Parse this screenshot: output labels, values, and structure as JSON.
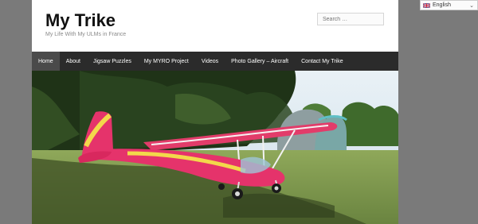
{
  "site": {
    "title": "My Trike",
    "tagline": "My Life With My ULMs in France"
  },
  "search": {
    "placeholder": "Search …"
  },
  "nav": {
    "items": [
      {
        "label": "Home",
        "active": true
      },
      {
        "label": "About"
      },
      {
        "label": "Jigsaw Puzzles"
      },
      {
        "label": "My MYRO Project"
      },
      {
        "label": "Videos"
      },
      {
        "label": "Photo Gallery – Aircraft"
      },
      {
        "label": "Contact My Trike"
      }
    ]
  },
  "language": {
    "selected": "English",
    "flag_icon": "uk-flag-icon"
  },
  "colors": {
    "nav_bg": "#2b2b2b",
    "nav_active": "#4a4a4a",
    "aircraft": "#e8336b",
    "aircraft_stripe": "#f2d24a"
  }
}
